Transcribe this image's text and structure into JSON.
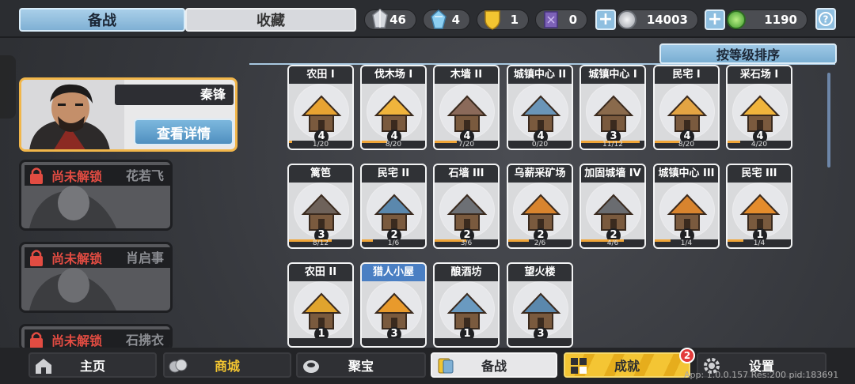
{
  "tabs": {
    "active": "备战",
    "inactive": "收藏"
  },
  "resources": [
    {
      "name": "silver-crystal",
      "value": "46",
      "color": "#c9ccd3"
    },
    {
      "name": "blue-crystal",
      "value": "4",
      "color": "#7fc3ea"
    },
    {
      "name": "gold-shield",
      "value": "1",
      "color": "#f1c232"
    },
    {
      "name": "purple-crystal",
      "value": "0",
      "color": "#8c6fc2"
    }
  ],
  "currency": {
    "silver": "14003",
    "jade": "1190"
  },
  "sort_label": "按等级排序",
  "hero": {
    "name": "秦锋",
    "detail_button": "查看详情"
  },
  "locked_heroes": [
    {
      "status": "尚未解锁",
      "name": "花若飞"
    },
    {
      "status": "尚未解锁",
      "name": "肖启事"
    },
    {
      "status": "尚未解锁",
      "name": "石拂衣"
    }
  ],
  "buildings": [
    {
      "name": "农田 I",
      "level": "4",
      "progress": "1/20",
      "ratio": 0.05,
      "color": "#e8a332",
      "blue": false
    },
    {
      "name": "伐木场 I",
      "level": "4",
      "progress": "8/20",
      "ratio": 0.4,
      "color": "#f0b43c",
      "blue": false
    },
    {
      "name": "木墙 II",
      "level": "4",
      "progress": "7/20",
      "ratio": 0.35,
      "color": "#8b6a5a",
      "blue": false
    },
    {
      "name": "城镇中心 II",
      "level": "4",
      "progress": "0/20",
      "ratio": 0.0,
      "color": "#6a95b8",
      "blue": false
    },
    {
      "name": "城镇中心 I",
      "level": "3",
      "progress": "11/12",
      "ratio": 0.92,
      "color": "#8a6a4c",
      "blue": false
    },
    {
      "name": "民宅 I",
      "level": "4",
      "progress": "8/20",
      "ratio": 0.4,
      "color": "#e3a443",
      "blue": false
    },
    {
      "name": "采石场 I",
      "level": "4",
      "progress": "4/20",
      "ratio": 0.2,
      "color": "#f0b43c",
      "blue": false
    },
    {
      "name": "篱笆",
      "level": "3",
      "progress": "8/12",
      "ratio": 0.67,
      "color": "#6e625a",
      "blue": false
    },
    {
      "name": "民宅 II",
      "level": "2",
      "progress": "1/6",
      "ratio": 0.17,
      "color": "#5b88ad",
      "blue": false
    },
    {
      "name": "石墙 III",
      "level": "2",
      "progress": "3/6",
      "ratio": 0.5,
      "color": "#6d7075",
      "blue": false
    },
    {
      "name": "乌薪采矿场",
      "level": "2",
      "progress": "2/6",
      "ratio": 0.33,
      "color": "#d8842e",
      "blue": false
    },
    {
      "name": "加固城墙 IV",
      "level": "2",
      "progress": "4/6",
      "ratio": 0.67,
      "color": "#6a6c70",
      "blue": false
    },
    {
      "name": "城镇中心 III",
      "level": "1",
      "progress": "1/4",
      "ratio": 0.25,
      "color": "#d8842e",
      "blue": false
    },
    {
      "name": "民宅 III",
      "level": "1",
      "progress": "1/4",
      "ratio": 0.25,
      "color": "#e48c2c",
      "blue": false
    },
    {
      "name": "农田 II",
      "level": "1",
      "progress": "",
      "ratio": 0.0,
      "color": "#e0a42e",
      "blue": false
    },
    {
      "name": "猎人小屋",
      "level": "3",
      "progress": "",
      "ratio": 0.0,
      "color": "#e89a2c",
      "blue": true
    },
    {
      "name": "酿酒坊",
      "level": "1",
      "progress": "",
      "ratio": 0.0,
      "color": "#6a9ac0",
      "blue": false
    },
    {
      "name": "望火楼",
      "level": "3",
      "progress": "",
      "ratio": 0.0,
      "color": "#5b88ad",
      "blue": false
    }
  ],
  "nav": [
    {
      "label": "主页",
      "icon": "home-icon"
    },
    {
      "label": "商城",
      "icon": "shop-icon"
    },
    {
      "label": "聚宝",
      "icon": "treasure-icon"
    },
    {
      "label": "备战",
      "icon": "prepare-icon"
    },
    {
      "label": "成就",
      "icon": "achievement-icon"
    },
    {
      "label": "设置",
      "icon": "gear-icon"
    }
  ],
  "achievement_badge": "2",
  "version": "App: 1.0.0.157 Res:200 pid:183691"
}
